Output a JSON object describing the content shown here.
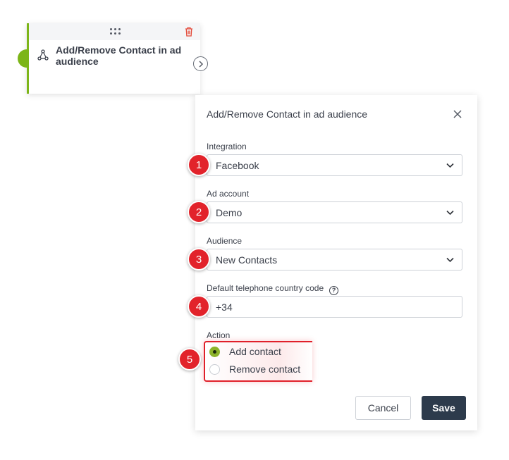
{
  "node": {
    "title": "Add/Remove Contact in ad audience",
    "accent_color": "#7cb518",
    "icons": [
      "drag-handle-icon",
      "trash-icon",
      "network-icon",
      "chevron-right-icon"
    ]
  },
  "panel": {
    "title": "Add/Remove Contact in ad audience",
    "fields": {
      "integration": {
        "label": "Integration",
        "value": "Facebook"
      },
      "ad_account": {
        "label": "Ad account",
        "value": "Demo"
      },
      "audience": {
        "label": "Audience",
        "value": "New Contacts"
      },
      "phone_code": {
        "label": "Default telephone country code",
        "value": "+34",
        "help": "?"
      }
    },
    "action": {
      "label": "Action",
      "options": [
        {
          "label": "Add contact",
          "checked": true
        },
        {
          "label": "Remove contact",
          "checked": false
        }
      ]
    },
    "buttons": {
      "cancel": "Cancel",
      "save": "Save"
    }
  },
  "markers": [
    "1",
    "2",
    "3",
    "4",
    "5"
  ],
  "colors": {
    "marker": "#e2232b",
    "save_button": "#2d3b4c",
    "radio_checked": "#8cb32a"
  }
}
